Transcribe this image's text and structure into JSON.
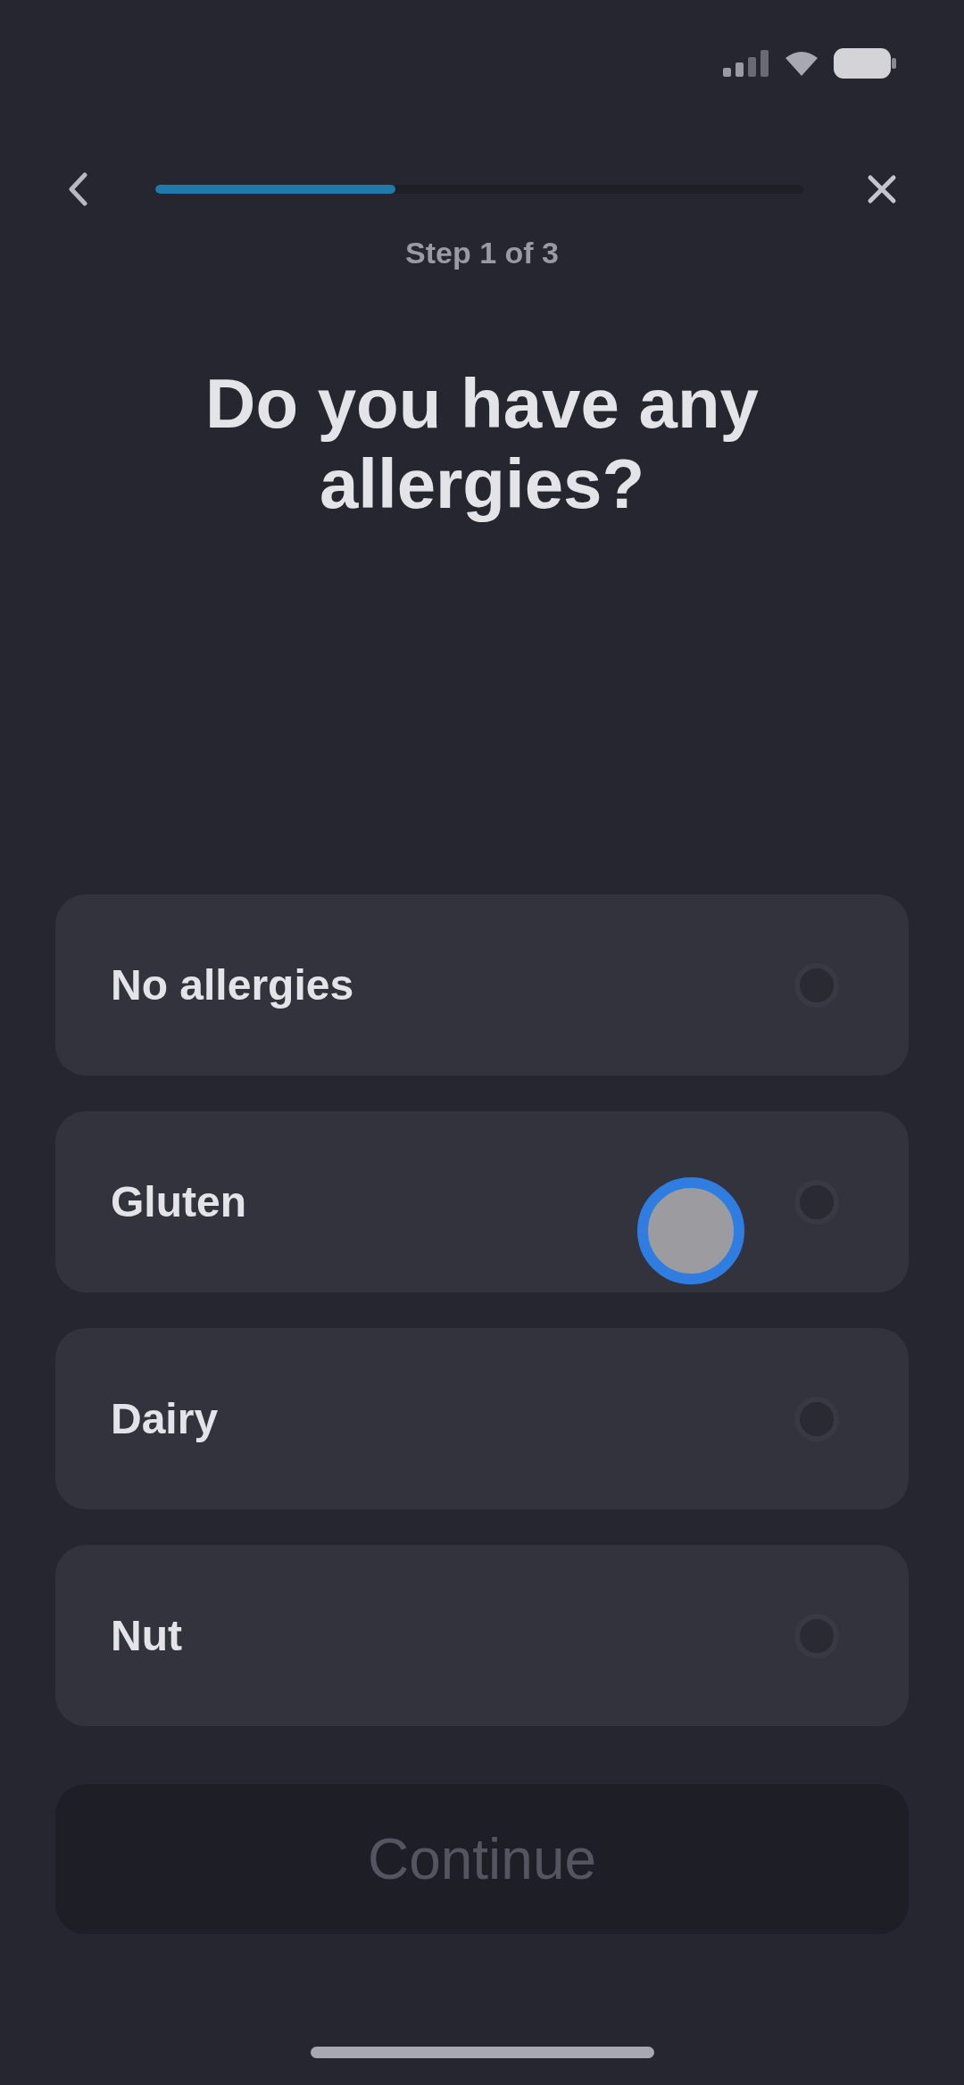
{
  "progress": {
    "level": 0.37,
    "label": "Step 1 of 3"
  },
  "title": "Do you have any allergies?",
  "options": [
    {
      "label": "No allergies",
      "selected": false
    },
    {
      "label": "Gluten",
      "selected": false
    },
    {
      "label": "Dairy",
      "selected": false
    },
    {
      "label": "Nut",
      "selected": false
    }
  ],
  "continue_button": {
    "label": "Continue",
    "disabled": true
  }
}
